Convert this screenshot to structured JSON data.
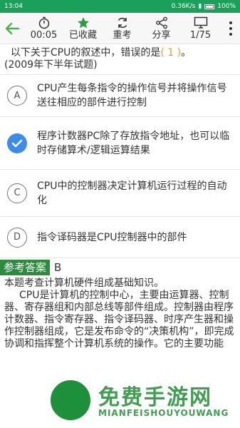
{
  "status": {
    "time": "13:04",
    "network": "0.36K/s",
    "battery": "100%"
  },
  "toolbar": {
    "timer": "00:05",
    "favorite": "已收藏",
    "retake": "重考",
    "share": "分享",
    "progress": "1/75"
  },
  "question": {
    "text": "以下关于CPU的叙述中，错误的是",
    "answer_mark": "( 1 )",
    "suffix": "。",
    "source": "(2009年下半年试题)"
  },
  "options": [
    {
      "letter": "A",
      "text": "CPU产生每条指令的操作信号并将操作信号送往相应的部件进行控制"
    },
    {
      "letter": "B",
      "text": "程序计数器PC除了存放指令地址，也可以临时存储算术/逻辑运算结果",
      "selected": true
    },
    {
      "letter": "C",
      "text": "CPU中的控制器决定计算机运行过程的自动化"
    },
    {
      "letter": "D",
      "text": "指令译码器是CPU控制器中的部件"
    }
  ],
  "answer": {
    "label": "参考答案",
    "value": "B"
  },
  "explanation": {
    "p1": "本题考查计算机硬件组成基础知识。",
    "p2": "CPU是计算机的控制中心，主要由运算器、控制器、寄存器组和内部总线等部件组成。控制器由程序计数器、指令寄存器、指令译码器、时序产生器和操作控制器组成，它是发布命令的“决策机构”，即完成协调和指挥整个计算机系统的操作。它的主要功能"
  },
  "watermark": {
    "title": "免费手游网",
    "subtitle": "MIANFEISHOUYOUWANG"
  },
  "colors": {
    "status_bar": "#1aa05a",
    "accent_green": "#2d8a3e",
    "selected_blue": "#3c8be8",
    "answer_orange": "#e0a020"
  }
}
